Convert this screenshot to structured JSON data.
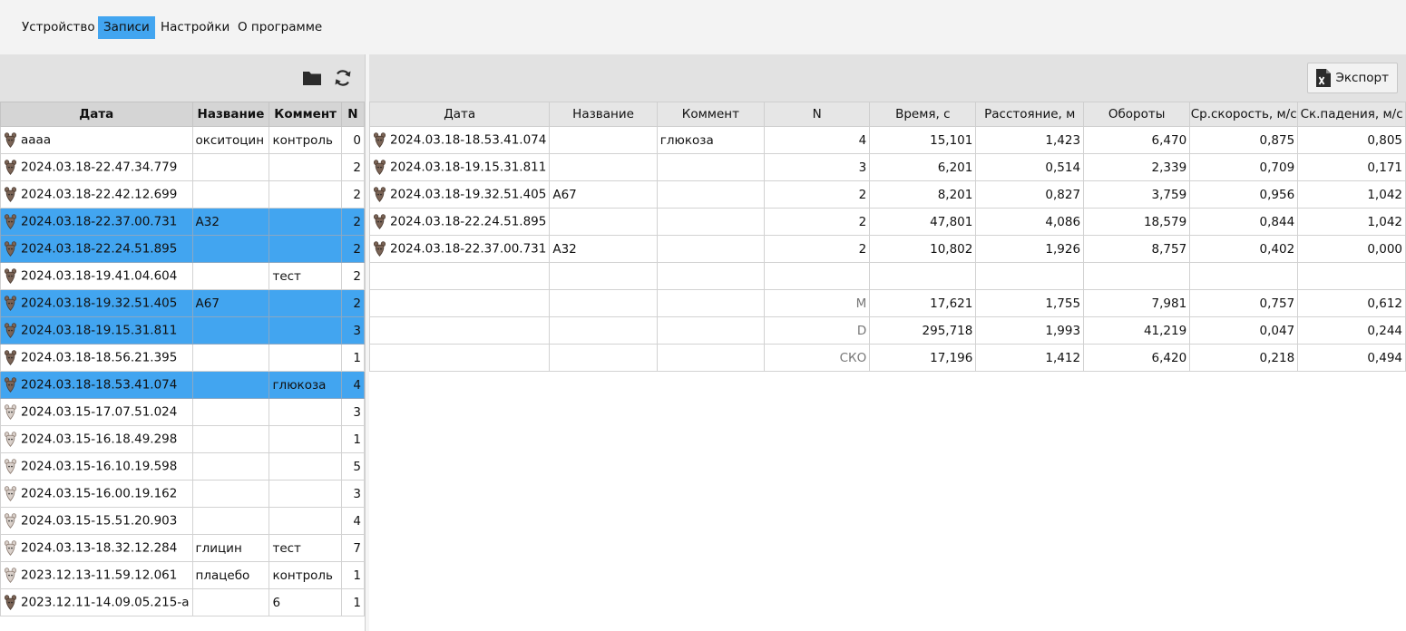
{
  "menu": {
    "device": "Устройство",
    "records": "Записи",
    "settings": "Настройки",
    "about": "О программе"
  },
  "icons": {
    "folder": "folder-icon",
    "refresh": "refresh-icon",
    "export": "excel-icon"
  },
  "colors": {
    "selection": "#42a5f0",
    "mouse_dark": "#7b6456",
    "mouse_light": "#d9d0ca"
  },
  "left": {
    "headers": {
      "date": "Дата",
      "name": "Название",
      "comment": "Коммент",
      "n": "N"
    },
    "rows": [
      {
        "date": "аааа",
        "name": "окситоцин",
        "comment": "контроль",
        "n": "0",
        "selected": false,
        "mouse": "dark"
      },
      {
        "date": "2024.03.18-22.47.34.779",
        "name": "",
        "comment": "",
        "n": "2",
        "selected": false,
        "mouse": "dark"
      },
      {
        "date": "2024.03.18-22.42.12.699",
        "name": "",
        "comment": "",
        "n": "2",
        "selected": false,
        "mouse": "dark"
      },
      {
        "date": "2024.03.18-22.37.00.731",
        "name": "А32",
        "comment": "",
        "n": "2",
        "selected": true,
        "mouse": "dark"
      },
      {
        "date": "2024.03.18-22.24.51.895",
        "name": "",
        "comment": "",
        "n": "2",
        "selected": true,
        "mouse": "dark"
      },
      {
        "date": "2024.03.18-19.41.04.604",
        "name": "",
        "comment": "тест",
        "n": "2",
        "selected": false,
        "mouse": "dark"
      },
      {
        "date": "2024.03.18-19.32.51.405",
        "name": "А67",
        "comment": "",
        "n": "2",
        "selected": true,
        "mouse": "dark"
      },
      {
        "date": "2024.03.18-19.15.31.811",
        "name": "",
        "comment": "",
        "n": "3",
        "selected": true,
        "mouse": "dark"
      },
      {
        "date": "2024.03.18-18.56.21.395",
        "name": "",
        "comment": "",
        "n": "1",
        "selected": false,
        "mouse": "dark"
      },
      {
        "date": "2024.03.18-18.53.41.074",
        "name": "",
        "comment": "глюкоза",
        "n": "4",
        "selected": true,
        "mouse": "dark"
      },
      {
        "date": "2024.03.15-17.07.51.024",
        "name": "",
        "comment": "",
        "n": "3",
        "selected": false,
        "mouse": "light"
      },
      {
        "date": "2024.03.15-16.18.49.298",
        "name": "",
        "comment": "",
        "n": "1",
        "selected": false,
        "mouse": "light"
      },
      {
        "date": "2024.03.15-16.10.19.598",
        "name": "",
        "comment": "",
        "n": "5",
        "selected": false,
        "mouse": "light"
      },
      {
        "date": "2024.03.15-16.00.19.162",
        "name": "",
        "comment": "",
        "n": "3",
        "selected": false,
        "mouse": "light"
      },
      {
        "date": "2024.03.15-15.51.20.903",
        "name": "",
        "comment": "",
        "n": "4",
        "selected": false,
        "mouse": "light"
      },
      {
        "date": "2024.03.13-18.32.12.284",
        "name": "глицин",
        "comment": "тест",
        "n": "7",
        "selected": false,
        "mouse": "light"
      },
      {
        "date": "2023.12.13-11.59.12.061",
        "name": "плацебо",
        "comment": "контроль",
        "n": "1",
        "selected": false,
        "mouse": "light"
      },
      {
        "date": "2023.12.11-14.09.05.215-a",
        "name": "",
        "comment": "6",
        "n": "1",
        "selected": false,
        "mouse": "dark"
      }
    ]
  },
  "right": {
    "export_label": "Экспорт",
    "headers": {
      "date": "Дата",
      "name": "Название",
      "comment": "Коммент",
      "n": "N",
      "time": "Время,  с",
      "distance": "Расстояние, м",
      "turns": "Обороты",
      "avg_speed": "Ср.скорость, м/с",
      "fall_speed": "Ск.падения, м/с"
    },
    "rows": [
      {
        "date": "2024.03.18-18.53.41.074",
        "name": "",
        "comment": "глюкоза",
        "n": "4",
        "time": "15,101",
        "distance": "1,423",
        "turns": "6,470",
        "avg_speed": "0,875",
        "fall_speed": "0,805"
      },
      {
        "date": "2024.03.18-19.15.31.811",
        "name": "",
        "comment": "",
        "n": "3",
        "time": "6,201",
        "distance": "0,514",
        "turns": "2,339",
        "avg_speed": "0,709",
        "fall_speed": "0,171"
      },
      {
        "date": "2024.03.18-19.32.51.405",
        "name": "А67",
        "comment": "",
        "n": "2",
        "time": "8,201",
        "distance": "0,827",
        "turns": "3,759",
        "avg_speed": "0,956",
        "fall_speed": "1,042"
      },
      {
        "date": "2024.03.18-22.24.51.895",
        "name": "",
        "comment": "",
        "n": "2",
        "time": "47,801",
        "distance": "4,086",
        "turns": "18,579",
        "avg_speed": "0,844",
        "fall_speed": "1,042"
      },
      {
        "date": "2024.03.18-22.37.00.731",
        "name": "А32",
        "comment": "",
        "n": "2",
        "time": "10,802",
        "distance": "1,926",
        "turns": "8,757",
        "avg_speed": "0,402",
        "fall_speed": "0,000"
      }
    ],
    "stats": [
      {
        "label": "M",
        "time": "17,621",
        "distance": "1,755",
        "turns": "7,981",
        "avg_speed": "0,757",
        "fall_speed": "0,612"
      },
      {
        "label": "D",
        "time": "295,718",
        "distance": "1,993",
        "turns": "41,219",
        "avg_speed": "0,047",
        "fall_speed": "0,244"
      },
      {
        "label": "СКО",
        "time": "17,196",
        "distance": "1,412",
        "turns": "6,420",
        "avg_speed": "0,218",
        "fall_speed": "0,494"
      }
    ]
  }
}
